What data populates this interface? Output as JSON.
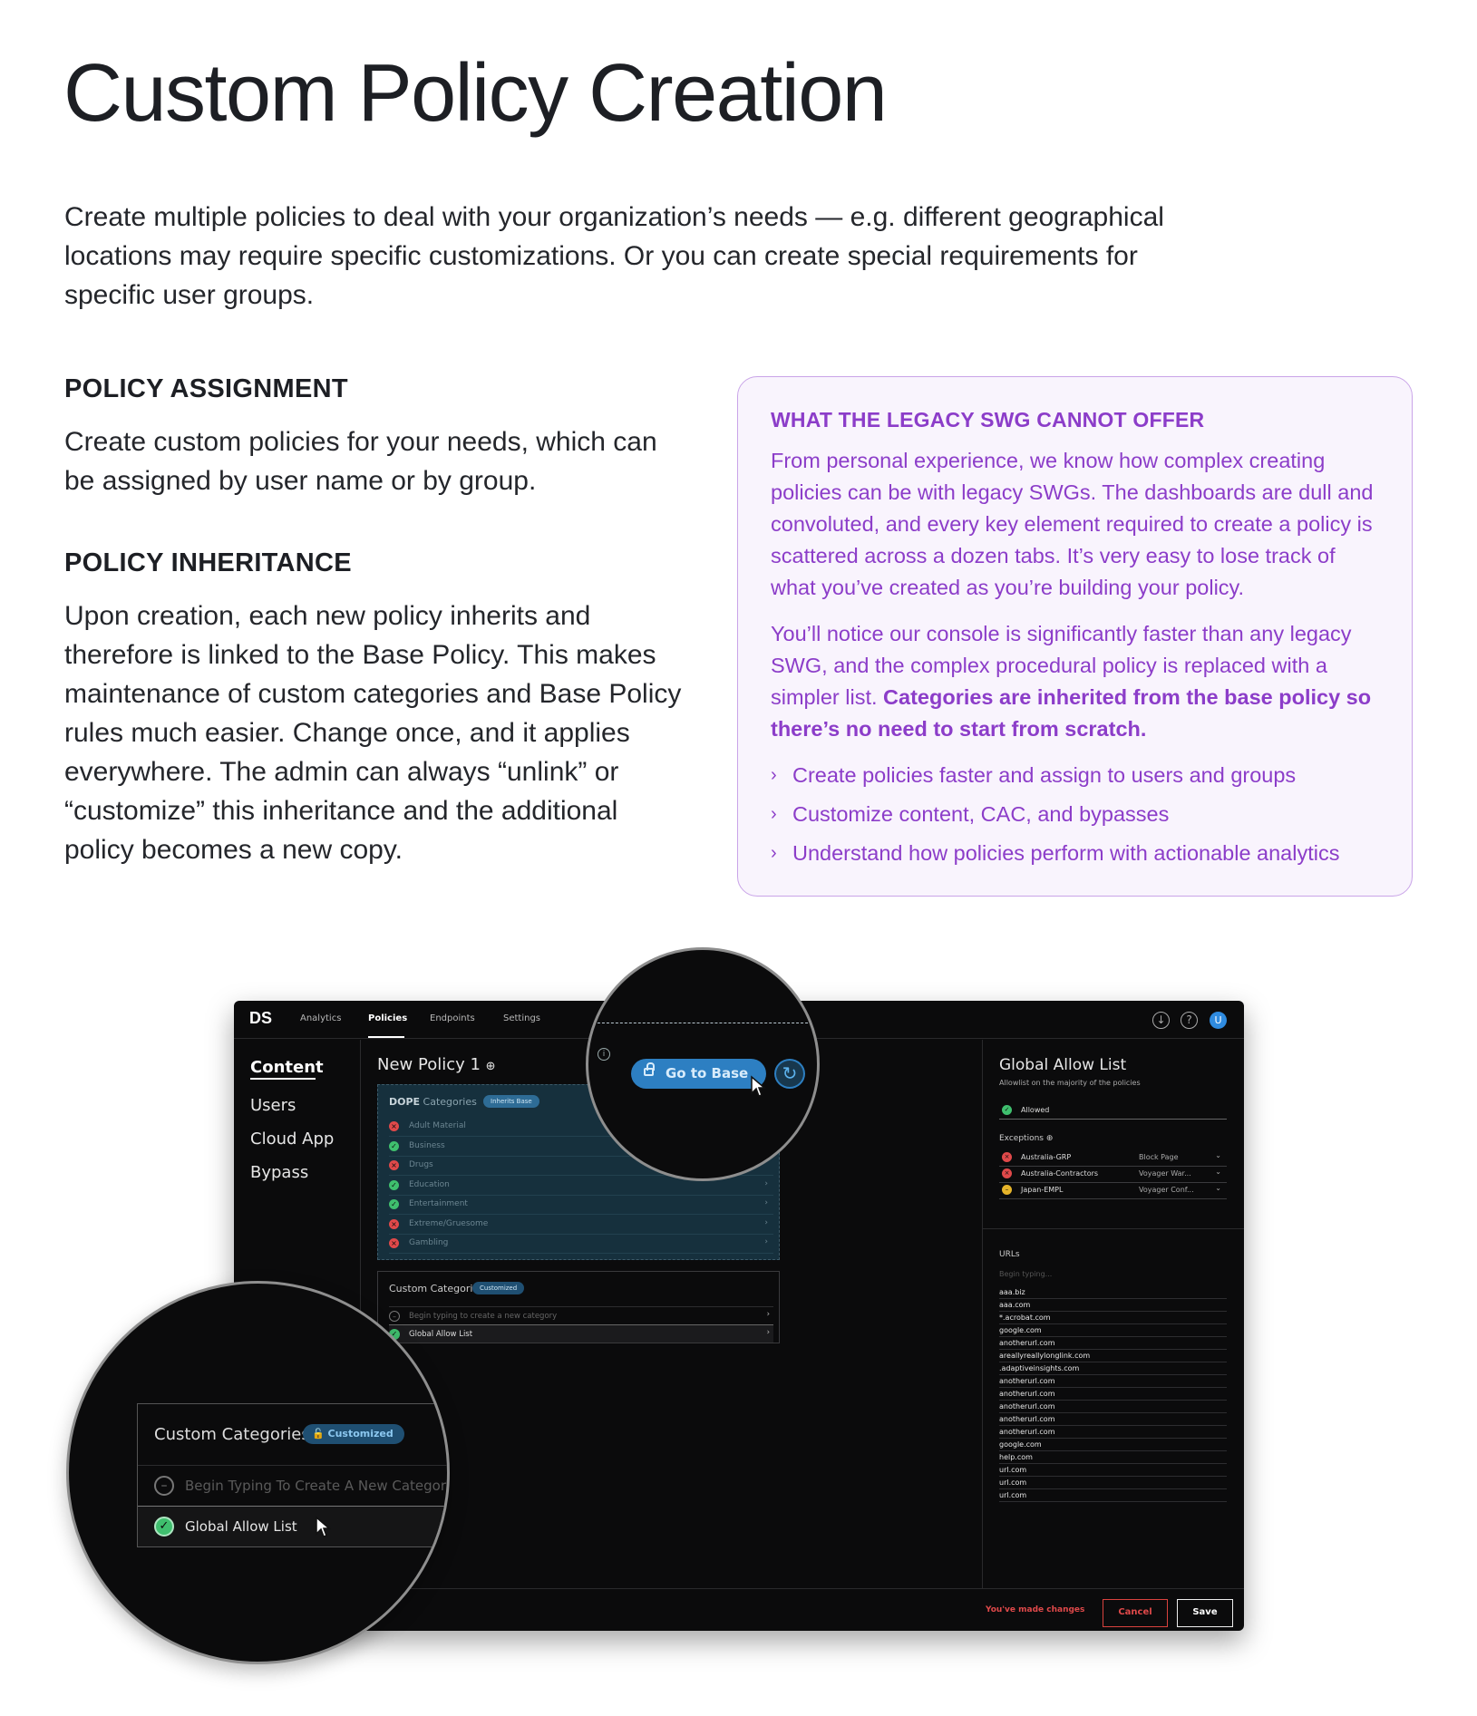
{
  "heading": "Custom Policy Creation",
  "intro": "Create multiple policies to deal with your organization’s needs — e.g. different geographical locations may require specific customizations. Or you can create special requirements for specific user groups.",
  "assignment": {
    "title": "POLICY ASSIGNMENT",
    "body": "Create custom policies for your needs, which can be assigned by user name or by group."
  },
  "inheritance": {
    "title": "POLICY INHERITANCE",
    "body": "Upon creation, each new policy inherits and therefore is linked to the Base Policy. This makes maintenance of custom categories and Base Policy rules much easier. Change once, and it applies everywhere. The admin can always “unlink” or “customize” this inheritance and the additional policy becomes a new copy."
  },
  "callout": {
    "title": "WHAT THE LEGACY SWG CANNOT OFFER",
    "p1": "From personal experience, we know how complex creating policies can be with legacy SWGs. The dashboards are dull and convoluted, and every key element required to create a policy is scattered across a dozen tabs. It’s very easy to lose track of what you’ve created as you’re building your policy.",
    "p2_plain": "You’ll notice our console is significantly faster than any legacy SWG, and the complex procedural policy is replaced with a simpler list. ",
    "p2_bold": "Categories are inherited from the base policy so there’s no need to start from scratch.",
    "bullets": [
      "Create policies faster and assign to users and groups",
      "Customize content, CAC, and bypasses",
      "Understand how policies perform with actionable analytics"
    ]
  },
  "app": {
    "logo": "DS",
    "nav": [
      "Analytics",
      "Policies",
      "Endpoints",
      "Settings"
    ],
    "sidebar": [
      "Content",
      "Users",
      "Cloud App",
      "Bypass"
    ],
    "policy_title": "New Policy 1",
    "dope": {
      "title_bold": "DOPE",
      "title_rest": " Categories",
      "badge": "Inherits Base",
      "items": [
        {
          "label": "Adult Material",
          "status": "blocked"
        },
        {
          "label": "Business",
          "status": "allowed"
        },
        {
          "label": "Drugs",
          "status": "blocked"
        },
        {
          "label": "Education",
          "status": "allowed"
        },
        {
          "label": "Entertainment",
          "status": "allowed"
        },
        {
          "label": "Extreme/Gruesome",
          "status": "blocked"
        },
        {
          "label": "Gambling",
          "status": "blocked"
        }
      ]
    },
    "custom": {
      "title": "Custom Categories",
      "badge": "Customized",
      "placeholder": "Begin typing to create a new category",
      "item": "Global Allow List"
    },
    "right": {
      "title": "Global Allow List",
      "subtitle": "Allowlist on the majority of the policies",
      "allowed": "Allowed",
      "exceptions_label": "Exceptions",
      "exceptions": [
        {
          "label": "Australia-GRP",
          "value": "Block Page",
          "status": "blocked"
        },
        {
          "label": "Australia-Contractors",
          "value": "Voyager War...",
          "status": "blocked"
        },
        {
          "label": "Japan-EMPL",
          "value": "Voyager Conf...",
          "status": "warn"
        }
      ],
      "urls_label": "URLs",
      "urls_placeholder": "Begin typing...",
      "urls": [
        "aaa.biz",
        "aaa.com",
        "*.acrobat.com",
        "google.com",
        "anotherurl.com",
        "areallyreallylonglink.com",
        ".adaptiveinsights.com",
        "anotherurl.com",
        "anotherurl.com",
        "anotherurl.com",
        "anotherurl.com",
        "anotherurl.com",
        "google.com",
        "help.com",
        "url.com",
        "url.com",
        "url.com"
      ]
    },
    "footer": {
      "changes": "You've made changes",
      "cancel": "Cancel",
      "save": "Save"
    }
  },
  "magnifier_top": {
    "button": "Go to Base"
  },
  "magnifier_bottom": {
    "title": "Custom Categories",
    "badge": "Customized",
    "placeholder": "Begin Typing To Create A New Category",
    "item": "Global Allow List"
  },
  "colors": {
    "accent_purple": "#8c3dc9",
    "app_bg": "#0b0b0c",
    "allowed": "#3fbf6e",
    "blocked": "#e0494a",
    "button_blue": "#2d7fc2"
  }
}
